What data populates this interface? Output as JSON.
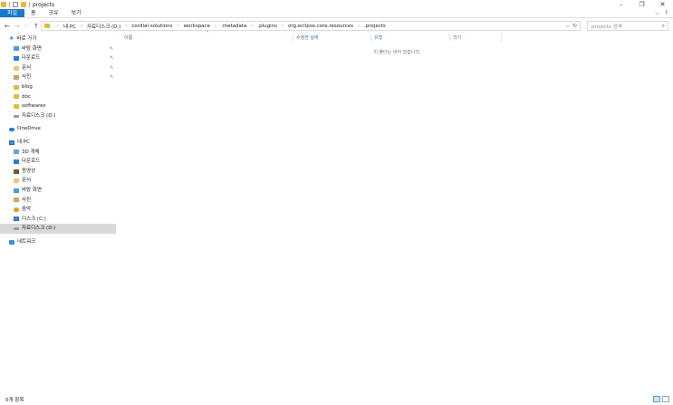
{
  "window": {
    "title": "projects",
    "controls": [
      "–",
      "❐",
      "✕"
    ]
  },
  "ribbon": {
    "tabs": [
      "파일",
      "홈",
      "공유",
      "보기"
    ],
    "right_icons": [
      "⌵",
      "?"
    ]
  },
  "nav_buttons": [
    "←",
    "→",
    "⌵",
    "↑"
  ],
  "address": {
    "crumbs": [
      "내 PC",
      "자료디스크 (D:)",
      "cordial-solutions",
      "workspace",
      ".metadata",
      ".plugins",
      "org.eclipse.core.resources",
      ".projects"
    ],
    "tools": [
      "⌵",
      "↻"
    ]
  },
  "search": {
    "placeholder": "projects 검색",
    "icon": "search-icon"
  },
  "sidebar": {
    "quick_access": {
      "label": "바로 가기",
      "items": [
        {
          "label": "바탕 화면",
          "pinned": true,
          "icon": "desktop-icon"
        },
        {
          "label": "다운로드",
          "pinned": true,
          "icon": "download-icon"
        },
        {
          "label": "문서",
          "pinned": true,
          "icon": "document-icon"
        },
        {
          "label": "사진",
          "pinned": true,
          "icon": "picture-icon"
        },
        {
          "label": "blog",
          "pinned": false,
          "icon": "folder-icon"
        },
        {
          "label": "doc",
          "pinned": false,
          "icon": "folder-icon"
        },
        {
          "label": "softwares",
          "pinned": false,
          "icon": "folder-icon"
        },
        {
          "label": "자료디스크 (D:)",
          "pinned": false,
          "icon": "drive-icon"
        }
      ]
    },
    "onedrive": "OneDrive",
    "this_pc": {
      "label": "내 PC",
      "items": [
        {
          "label": "3D 개체",
          "icon": "3d-objects-icon"
        },
        {
          "label": "다운로드",
          "icon": "download-icon"
        },
        {
          "label": "동영상",
          "icon": "video-icon"
        },
        {
          "label": "문서",
          "icon": "document-icon"
        },
        {
          "label": "바탕 화면",
          "icon": "desktop-icon"
        },
        {
          "label": "사진",
          "icon": "picture-icon"
        },
        {
          "label": "음악",
          "icon": "music-icon"
        },
        {
          "label": "디스크 (C:)",
          "icon": "drive-icon"
        },
        {
          "label": "자료디스크 (D:)",
          "icon": "drive-icon",
          "selected": true
        }
      ]
    },
    "network": "네트워크",
    "pin_glyph": "📌"
  },
  "content": {
    "columns": [
      "이름",
      "수정한 날짜",
      "유형",
      "크기"
    ],
    "sort_glyph": "^",
    "empty_message": "이 폴더는 비어 있습니다."
  },
  "status": {
    "count": "0개 항목"
  }
}
